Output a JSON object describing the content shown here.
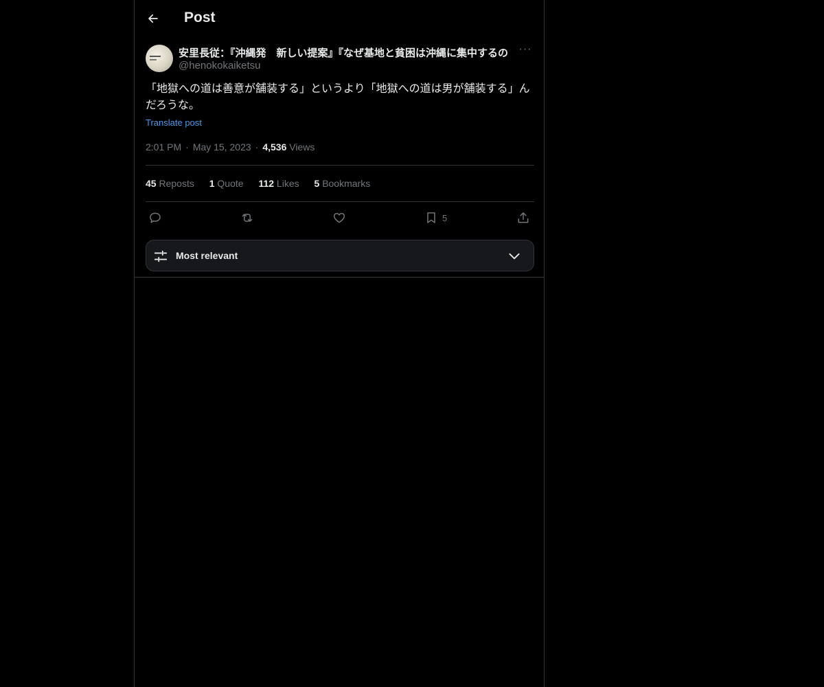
{
  "header": {
    "title": "Post"
  },
  "post": {
    "author": {
      "display_name": "安里長従：『沖縄発　新しい提案』『なぜ基地と貧困は沖縄に集中するの",
      "handle": "@henokokaiketsu"
    },
    "text": "「地獄への道は善意が舗装する」というより「地獄への道は男が舗装する」んだろうな。",
    "translate_label": "Translate post",
    "time": "2:01 PM",
    "date": "May 15, 2023",
    "views_count": "4,536",
    "views_label": "Views",
    "stats": [
      {
        "count": "45",
        "label": "Reposts"
      },
      {
        "count": "1",
        "label": "Quote"
      },
      {
        "count": "112",
        "label": "Likes"
      },
      {
        "count": "5",
        "label": "Bookmarks"
      }
    ],
    "actions": {
      "reply_icon": "reply-icon",
      "repost_icon": "repost-icon",
      "like_icon": "heart-icon",
      "bookmark_icon": "bookmark-icon",
      "bookmark_count": "5",
      "share_icon": "share-icon"
    }
  },
  "replies_sort": {
    "label": "Most relevant"
  },
  "colors": {
    "background": "#000000",
    "text": "#e7e9ea",
    "muted": "#71767b",
    "link": "#4a99e9",
    "border": "#2f3336",
    "sort_bar": "#16181c"
  }
}
